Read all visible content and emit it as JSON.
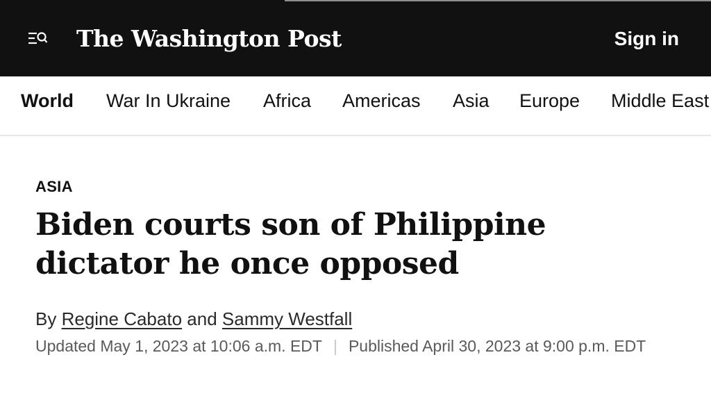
{
  "header": {
    "logo_text": "The Washington Post",
    "sign_in_label": "Sign in",
    "menu_icon": "menu-search-icon"
  },
  "nav": {
    "items": [
      {
        "label": "World",
        "active": true
      },
      {
        "label": "War In Ukraine"
      },
      {
        "label": "Africa"
      },
      {
        "label": "Americas"
      },
      {
        "label": "Asia"
      },
      {
        "label": "Europe"
      },
      {
        "label": "Middle East"
      }
    ]
  },
  "article": {
    "kicker": "ASIA",
    "headline": "Biden courts son of Philippine dictator he once opposed",
    "byline": {
      "prefix": "By",
      "author1": "Regine Cabato",
      "conjunction": "and",
      "author2": "Sammy Westfall"
    },
    "updated": "Updated May 1, 2023 at 10:06 a.m. EDT",
    "separator": "|",
    "published": "Published April 30, 2023 at 9:00 p.m. EDT"
  },
  "colors": {
    "header_bg": "#111111",
    "header_text": "#ffffff",
    "body_text": "#111111",
    "meta_text": "#5a5a5a"
  }
}
